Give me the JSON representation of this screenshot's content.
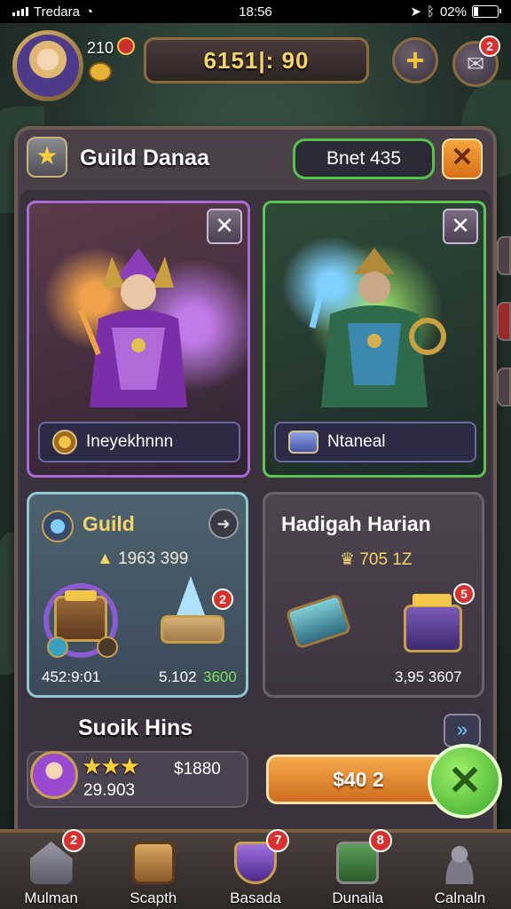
{
  "status_bar": {
    "carrier": "Tredara",
    "time": "18:56",
    "battery": "02%"
  },
  "hud": {
    "player_level": "210",
    "currency_value": "6151|: 90",
    "mail_badge": "2"
  },
  "panel": {
    "title": "Guild Danaa",
    "pill_text": "Bnet 435",
    "close_glyph": "✕"
  },
  "heroes": [
    {
      "label": "Ineyekhnnn",
      "theme": "#a86bd6"
    },
    {
      "label": "Ntaneal",
      "theme": "#5ec34f"
    }
  ],
  "guild_card": {
    "title": "Guild",
    "value": "1963 399",
    "footer_left": "452:9:01",
    "footer_right_a": "5.102",
    "footer_right_b": "3600",
    "crystal_badge": "2"
  },
  "daily_card": {
    "title": "Hadigah Harian",
    "value": "705 1Z",
    "footer": "3,95 3607",
    "chest_badge": "5"
  },
  "section": {
    "title": "Suoik Hins",
    "row_value_a": "$1880",
    "row_value_b": "29.903",
    "buy_label": "$40 2"
  },
  "nav": [
    {
      "label": "Mulman",
      "badge": "2",
      "icon": "home-icon"
    },
    {
      "label": "Scapth",
      "badge": "",
      "icon": "crate-icon"
    },
    {
      "label": "Basada",
      "badge": "7",
      "icon": "shield-icon"
    },
    {
      "label": "Dunaila",
      "badge": "8",
      "icon": "flag-icon"
    },
    {
      "label": "Calnaln",
      "badge": "",
      "icon": "people-icon"
    }
  ],
  "colors": {
    "accent_gold": "#f5d56a",
    "panel_bg": "#3a3440",
    "confirm_green": "#3aa82a",
    "alert_red": "#d9302c"
  }
}
